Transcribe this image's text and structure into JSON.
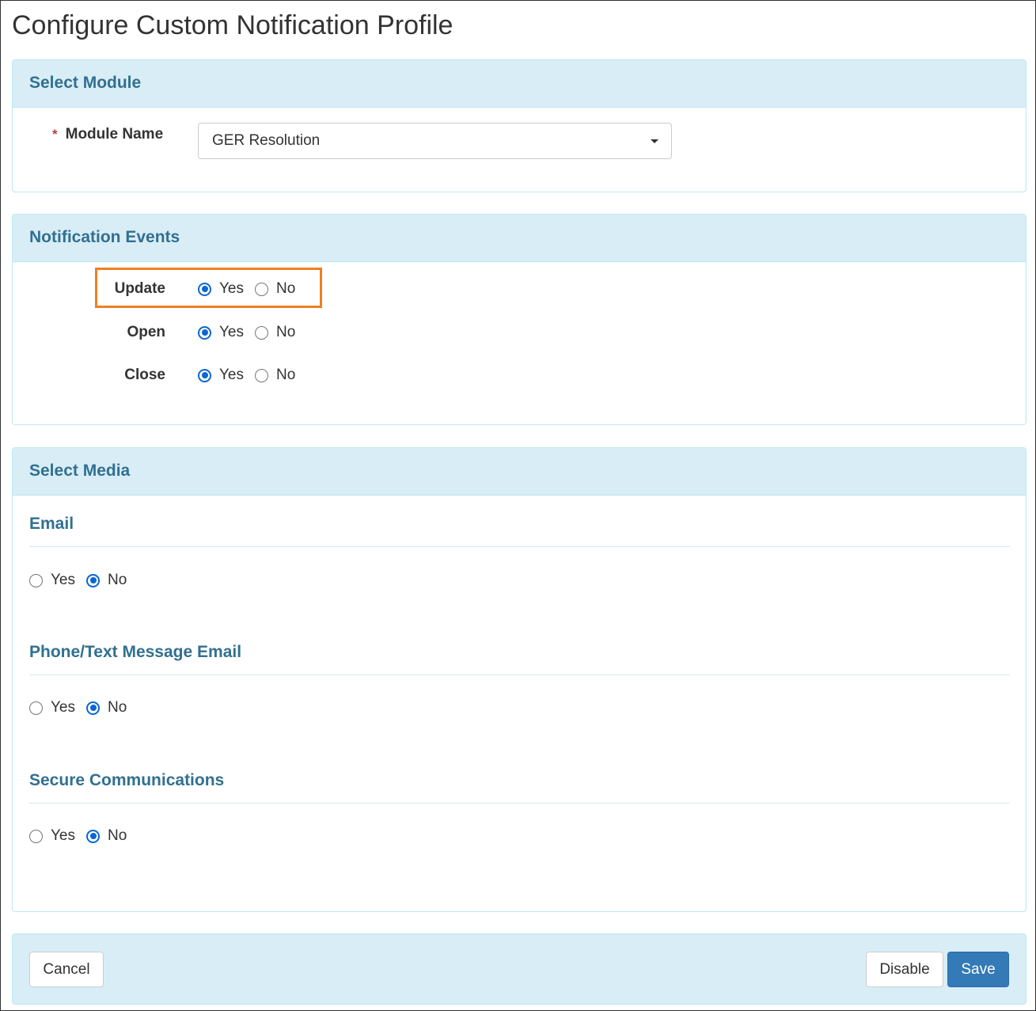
{
  "page": {
    "title": "Configure Custom Notification Profile"
  },
  "select_module": {
    "heading": "Select Module",
    "required_mark": "*",
    "module_name_label": "Module Name",
    "module_name_value": "GER Resolution"
  },
  "notification_events": {
    "heading": "Notification Events",
    "events": [
      {
        "label": "Update",
        "yes": "Yes",
        "no": "No",
        "selected": "Yes",
        "highlighted": true
      },
      {
        "label": "Open",
        "yes": "Yes",
        "no": "No",
        "selected": "Yes"
      },
      {
        "label": "Close",
        "yes": "Yes",
        "no": "No",
        "selected": "Yes"
      }
    ]
  },
  "select_media": {
    "heading": "Select Media",
    "media": [
      {
        "title": "Email",
        "yes": "Yes",
        "no": "No",
        "selected": "No"
      },
      {
        "title": "Phone/Text Message Email",
        "yes": "Yes",
        "no": "No",
        "selected": "No"
      },
      {
        "title": "Secure Communications",
        "yes": "Yes",
        "no": "No",
        "selected": "No"
      }
    ]
  },
  "footer": {
    "cancel_label": "Cancel",
    "disable_label": "Disable",
    "save_label": "Save"
  },
  "colors": {
    "panel_heading_bg": "#d9edf7",
    "panel_heading_text": "#31708f",
    "primary_button": "#337ab7",
    "highlight_border": "#ef7f22",
    "radio_selected": "#0a66d4"
  }
}
